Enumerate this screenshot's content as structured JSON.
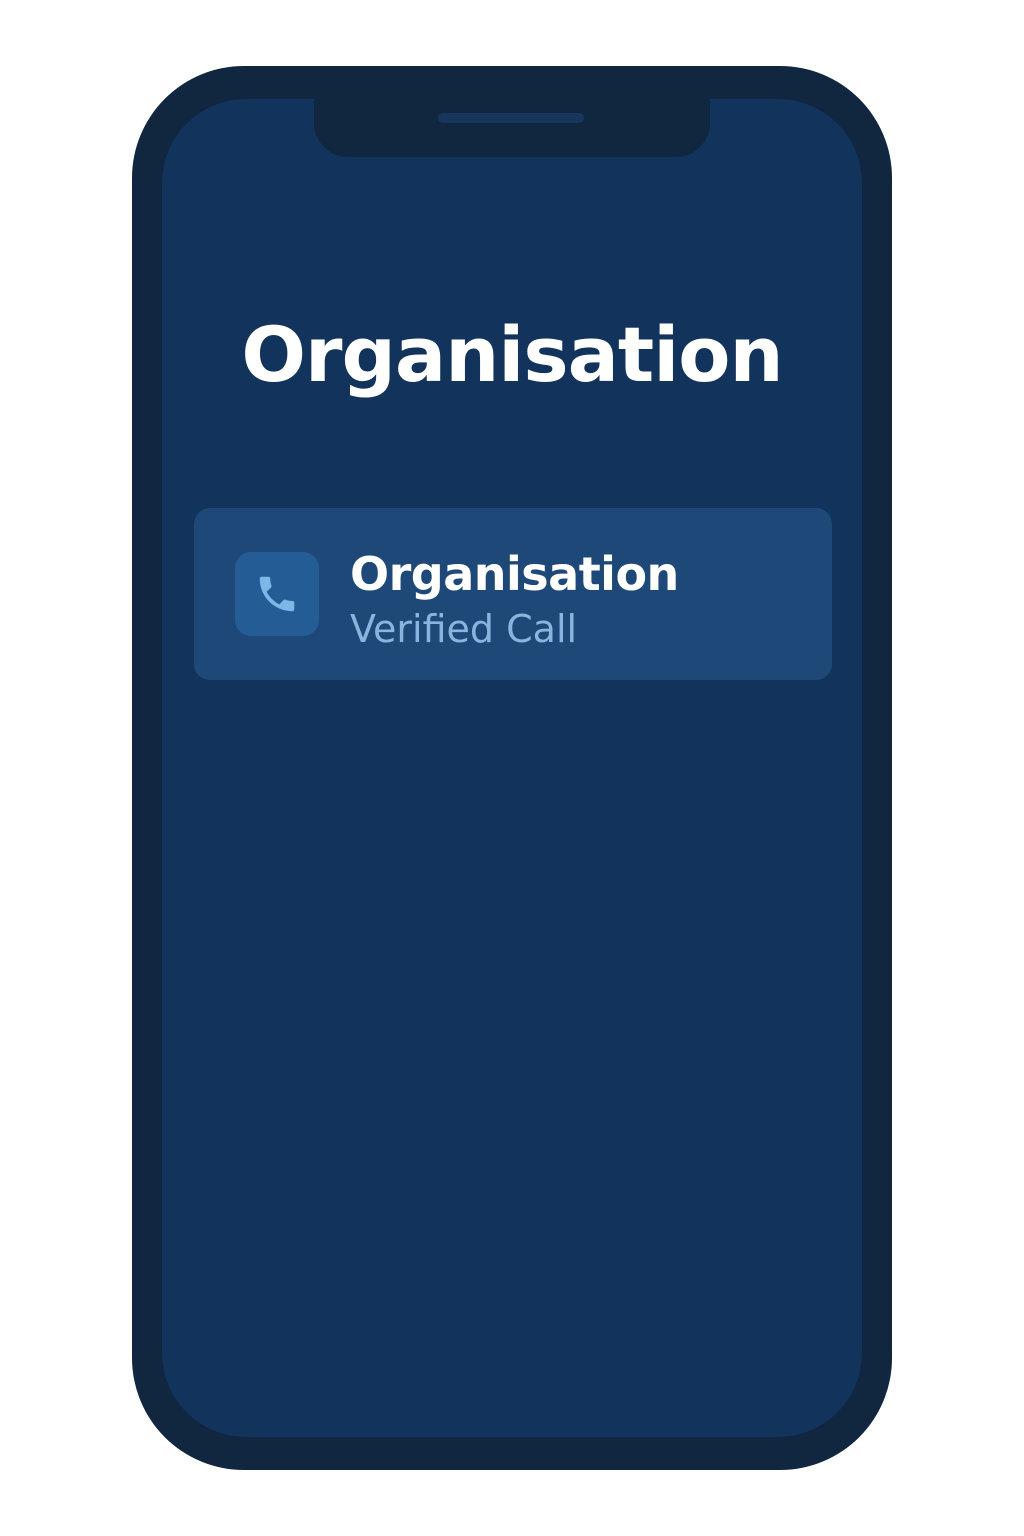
{
  "screen": {
    "title": "Organisation"
  },
  "incoming_call": {
    "icon": "phone-icon",
    "caller_name": "Organisation",
    "status": "Verified Call"
  },
  "colors": {
    "frame": "#10273f",
    "screen_background": "#12335c",
    "card_background": "#1d4878",
    "icon_tile": "#245c96",
    "icon_glyph": "#7fb6e8",
    "primary_text": "#ffffff",
    "secondary_text": "#8ab4de"
  }
}
